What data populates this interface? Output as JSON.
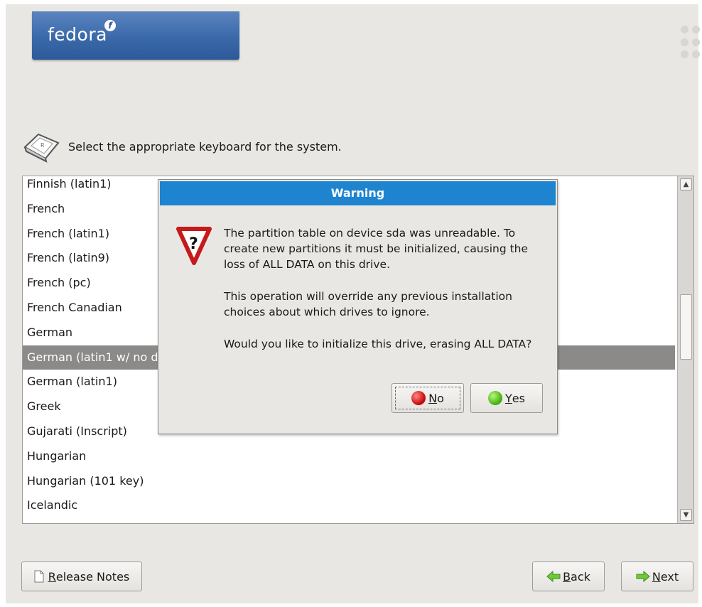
{
  "header": {
    "logo_text": "fedora",
    "logo_mark": "f",
    "brand_color": "#3a69aa"
  },
  "prompt": {
    "icon": "keyboard-icon",
    "text": "Select the appropriate keyboard for the system."
  },
  "keyboard_list": {
    "items": [
      "Finnish (latin1)",
      "French",
      "French (latin1)",
      "French (latin9)",
      "French (pc)",
      "French Canadian",
      "German",
      "German (latin1 w/ no d",
      "German (latin1)",
      "Greek",
      "Gujarati (Inscript)",
      "Hungarian",
      "Hungarian (101 key)",
      "Icelandic"
    ],
    "selected": "German (latin1 w/ no d"
  },
  "dialog": {
    "title": "Warning",
    "title_color": "#1e84cf",
    "icon": "warning-question-icon",
    "paragraph1": "The partition table on device sda was unreadable. To create new partitions it must be initialized, causing the loss of ALL DATA on this drive.",
    "paragraph2": "This operation will override any previous installation choices about which drives to ignore.",
    "paragraph3": "Would you like to initialize this drive, erasing ALL DATA?",
    "no_button": {
      "mnemonic": "N",
      "rest": "o"
    },
    "yes_button": {
      "mnemonic": "Y",
      "rest": "es"
    }
  },
  "footer": {
    "release_notes": {
      "mnemonic": "R",
      "rest": "elease Notes"
    },
    "back": {
      "mnemonic": "B",
      "rest": "ack"
    },
    "next": {
      "mnemonic": "N",
      "rest": "ext"
    }
  }
}
